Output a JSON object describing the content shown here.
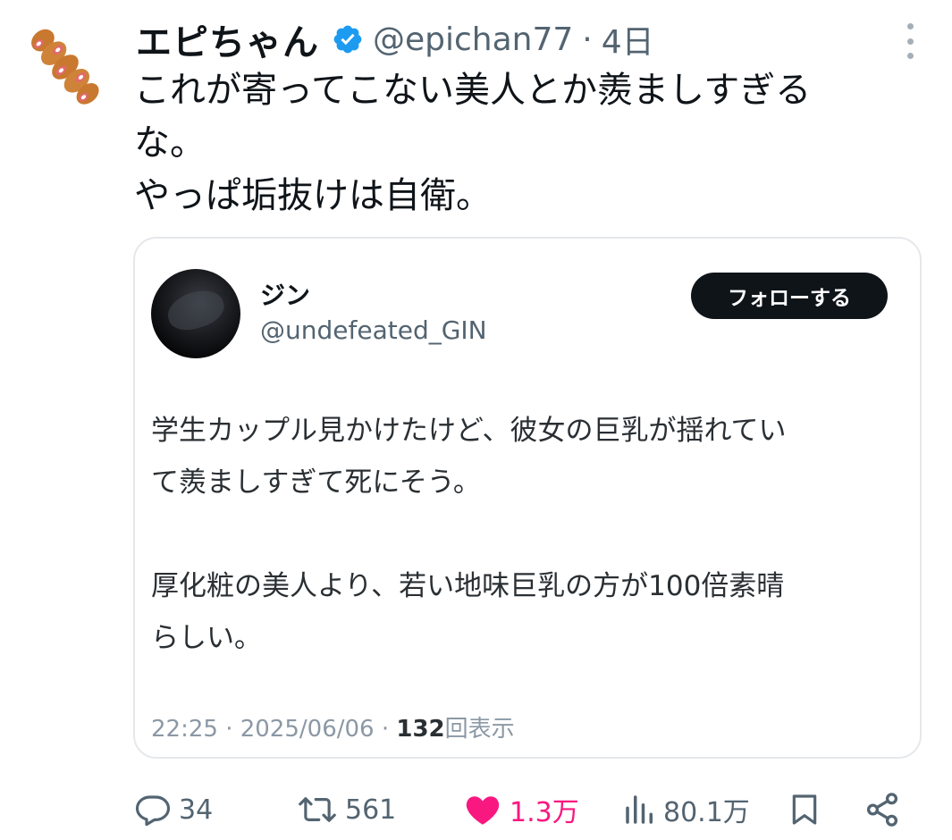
{
  "tweet": {
    "display_name": "エピちゃん",
    "handle": "@epichan77",
    "separator": "·",
    "time": "4日",
    "text": "これが寄ってこない美人とか羨ましすぎる\nな。\nやっぱ垢抜けは自衛。"
  },
  "quote": {
    "display_name": "ジン",
    "handle": "@undefeated_GIN",
    "follow_label": "フォローする",
    "text": "学生カップル見かけたけど、彼女の巨乳が揺れてい\nて羨ましすぎて死にそう。\n\n厚化粧の美人より、若い地味巨乳の方が100倍素晴\nらしい。",
    "meta_time": "22:25 · 2025/06/06 · ",
    "meta_views": "132",
    "meta_views_label": "回表示"
  },
  "actions": {
    "reply": "34",
    "retweet": "561",
    "like": "1.3万",
    "views": "80.1万"
  },
  "colors": {
    "like_active": "#f91880",
    "verified": "#1d9bf0",
    "secondary_text": "#536471",
    "follow_button": "#0f1419"
  },
  "icons": [
    "verified-badge-icon",
    "more-icon",
    "reply-icon",
    "retweet-icon",
    "heart-icon",
    "views-icon",
    "bookmark-icon",
    "share-icon"
  ]
}
